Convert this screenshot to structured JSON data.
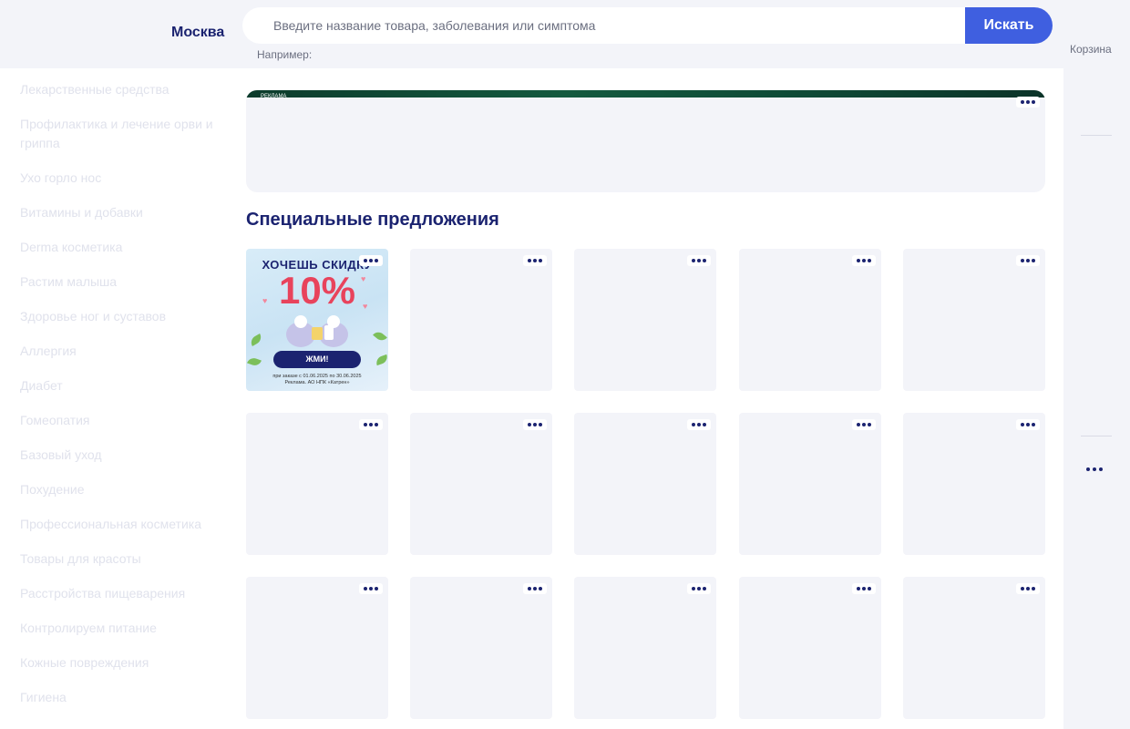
{
  "header": {
    "city": "Москва",
    "search_placeholder": "Введите название товара, заболевания или симптома",
    "search_button": "Искать",
    "hint": "Например:"
  },
  "right_panel": {
    "cart_label": "Корзина"
  },
  "sidebar": {
    "categories": [
      "Лекарственные средства",
      "Профилактика и лечение орви и гриппа",
      "Ухо горло нос",
      "Витамины и добавки",
      "Derma косметика",
      "Растим малыша",
      "Здоровье ног и суставов",
      "Аллергия",
      "Диабет",
      "Гомеопатия",
      "Базовый уход",
      "Похудение",
      "Профессиональная косметика",
      "Товары для красоты",
      "Расстройства пищеварения",
      "Контролируем питание",
      "Кожные повреждения",
      "Гигиена"
    ]
  },
  "banner": {
    "ad_label": "РЕКЛАМА"
  },
  "specials": {
    "title": "Специальные предложения",
    "promo": {
      "headline": "ХОЧЕШЬ СКИДКУ",
      "percent": "10%",
      "button": "ЖМИ!",
      "note_line1": "при заказе с 01.06.2025 по 30.06.2025",
      "note_line2": "Реклама. АО НПК «Катрен»"
    }
  },
  "colors": {
    "brand_dark": "#1b2370",
    "accent_blue": "#3f5fe0",
    "promo_red": "#e8435c",
    "placeholder_bg": "#f3f4f9"
  }
}
